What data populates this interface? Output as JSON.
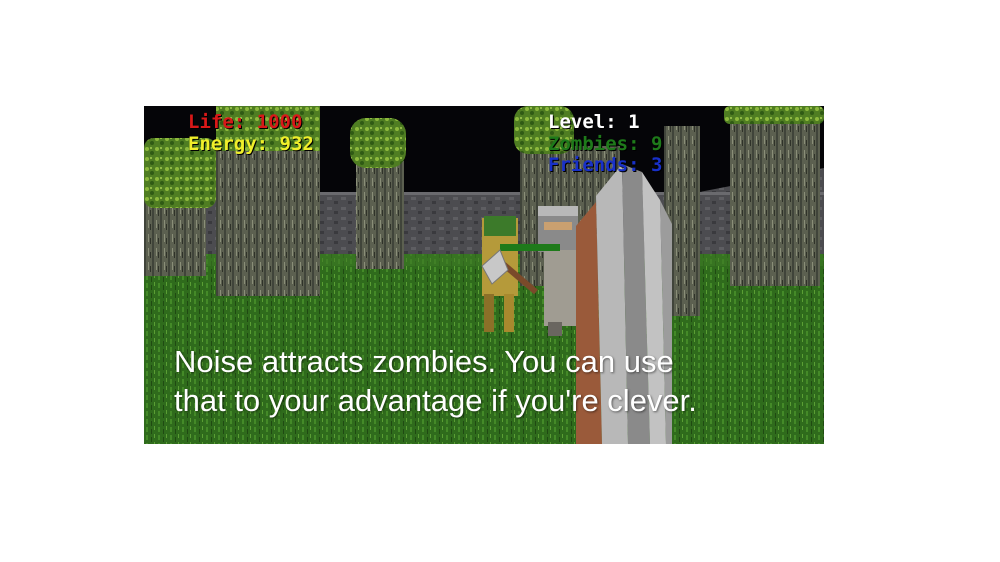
{
  "hud": {
    "life": "Life: 1000",
    "energy": "Energy: 932",
    "level": "Level: 1",
    "zombies": "Zombies: 9",
    "friends": "Friends: 3"
  },
  "tip": {
    "line1": "Noise attracts zombies. You can use",
    "line2": "that to your advantage if you're clever."
  },
  "colors": {
    "life": "#d81818",
    "energy": "#f0ef2a",
    "level": "#ffffff",
    "zombies": "#1e7a1a",
    "friends": "#1830c8",
    "grass": "#2f6b1c",
    "foliage": "#6a9a2a",
    "bark": "#5a5e4c",
    "wall": "#4c4c50"
  },
  "scene": {
    "objects": [
      "trees",
      "stone-wall",
      "zombie",
      "friend-with-axe",
      "shield"
    ]
  }
}
